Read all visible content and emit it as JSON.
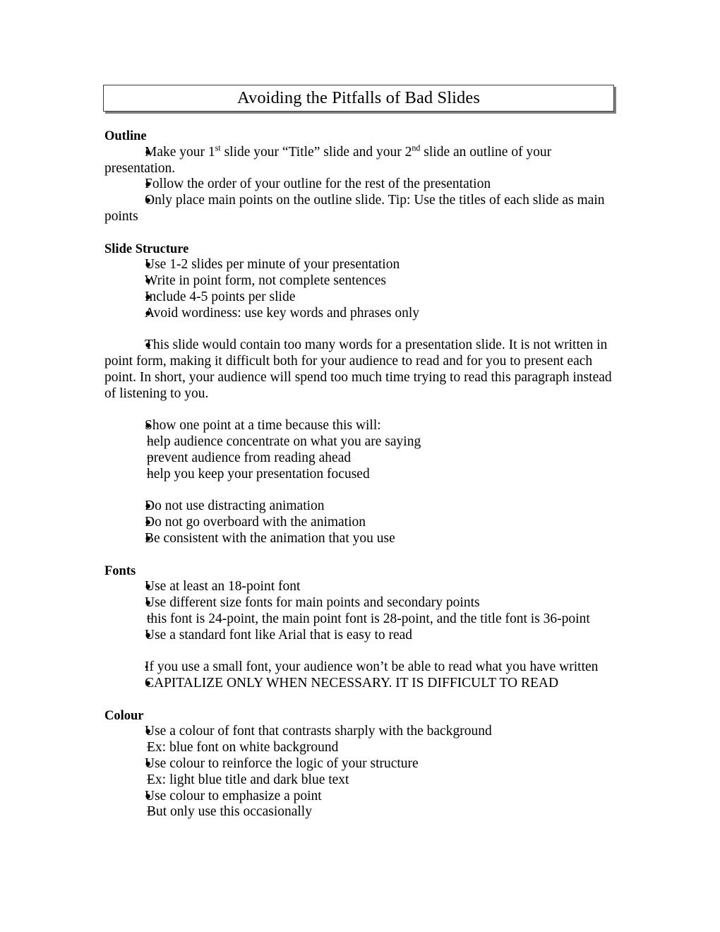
{
  "document": {
    "title": "Avoiding the Pitfalls of Bad Slides"
  },
  "sections": [
    {
      "heading": "Outline",
      "items": [
        {
          "marker": "bullet",
          "text_prefix": "Make your 1",
          "sup1": "st",
          "text_mid": " slide your “Title” slide and your 2",
          "sup2": "nd",
          "text_suffix": " slide an outline of your presentation."
        },
        {
          "marker": "bullet",
          "text": "Follow the order of your outline for the rest of the presentation"
        },
        {
          "marker": "bullet",
          "text": "Only place main points on the outline slide. Tip: Use the titles of each slide as main points"
        }
      ]
    },
    {
      "heading": "Slide Structure",
      "items": [
        {
          "marker": "bullet",
          "text": "Use 1-2 slides per minute of your presentation"
        },
        {
          "marker": "bullet",
          "text": "Write in point form, not complete sentences"
        },
        {
          "marker": "bullet",
          "text": "Include 4-5 points per slide"
        },
        {
          "marker": "bullet",
          "text": "Avoid wordiness: use key words and phrases only"
        }
      ]
    },
    {
      "heading": "",
      "items": [
        {
          "marker": "bullet",
          "text": "This slide would contain too many words for a presentation slide.  It is not written in point form, making it difficult both for your audience to read and for you to present each point. In short, your audience will spend too much time trying to read this paragraph instead of listening to you."
        }
      ]
    },
    {
      "heading": "",
      "items": [
        {
          "marker": "bullet",
          "text": "Show one point at a time because this will:"
        },
        {
          "marker": "dash",
          "text": "help audience concentrate on what you are saying"
        },
        {
          "marker": "dash",
          "text": "prevent audience from reading ahead"
        },
        {
          "marker": "dash",
          "text": "help you keep your presentation focused"
        }
      ]
    },
    {
      "heading": "",
      "items": [
        {
          "marker": "bullet",
          "text": "Do not use distracting animation"
        },
        {
          "marker": "bullet",
          "text": "Do not go overboard with the animation"
        },
        {
          "marker": "bullet",
          "text": "Be consistent with the animation that you use"
        }
      ]
    },
    {
      "heading": "Fonts",
      "items": [
        {
          "marker": "bullet",
          "text": "Use at least an 18-point font"
        },
        {
          "marker": "bullet",
          "text": "Use different size fonts for main points and secondary points"
        },
        {
          "marker": "dash",
          "text": "this font is 24-point, the main point font is 28-point, and the title font is 36-point"
        },
        {
          "marker": "bullet",
          "text": "Use a standard font like Arial that is easy to read"
        }
      ]
    },
    {
      "heading": "",
      "items": [
        {
          "marker": "bullet-small",
          "text": "If you use a small font, your audience won’t be able to read what you have written"
        },
        {
          "marker": "bullet",
          "text": "CAPITALIZE ONLY WHEN NECESSARY.  IT IS DIFFICULT TO READ"
        }
      ]
    },
    {
      "heading": "Colour",
      "items": [
        {
          "marker": "bullet",
          "text": "Use a colour of font that contrasts sharply with the background"
        },
        {
          "marker": "dash",
          "text": "Ex: blue font on white background"
        },
        {
          "marker": "bullet",
          "text": "Use colour to reinforce the logic of your structure"
        },
        {
          "marker": "dash",
          "text": "Ex: light blue title and dark blue text"
        },
        {
          "marker": "bullet",
          "text": "Use colour to emphasize a point"
        },
        {
          "marker": "dash",
          "text": "But only use this occasionally"
        }
      ]
    }
  ]
}
